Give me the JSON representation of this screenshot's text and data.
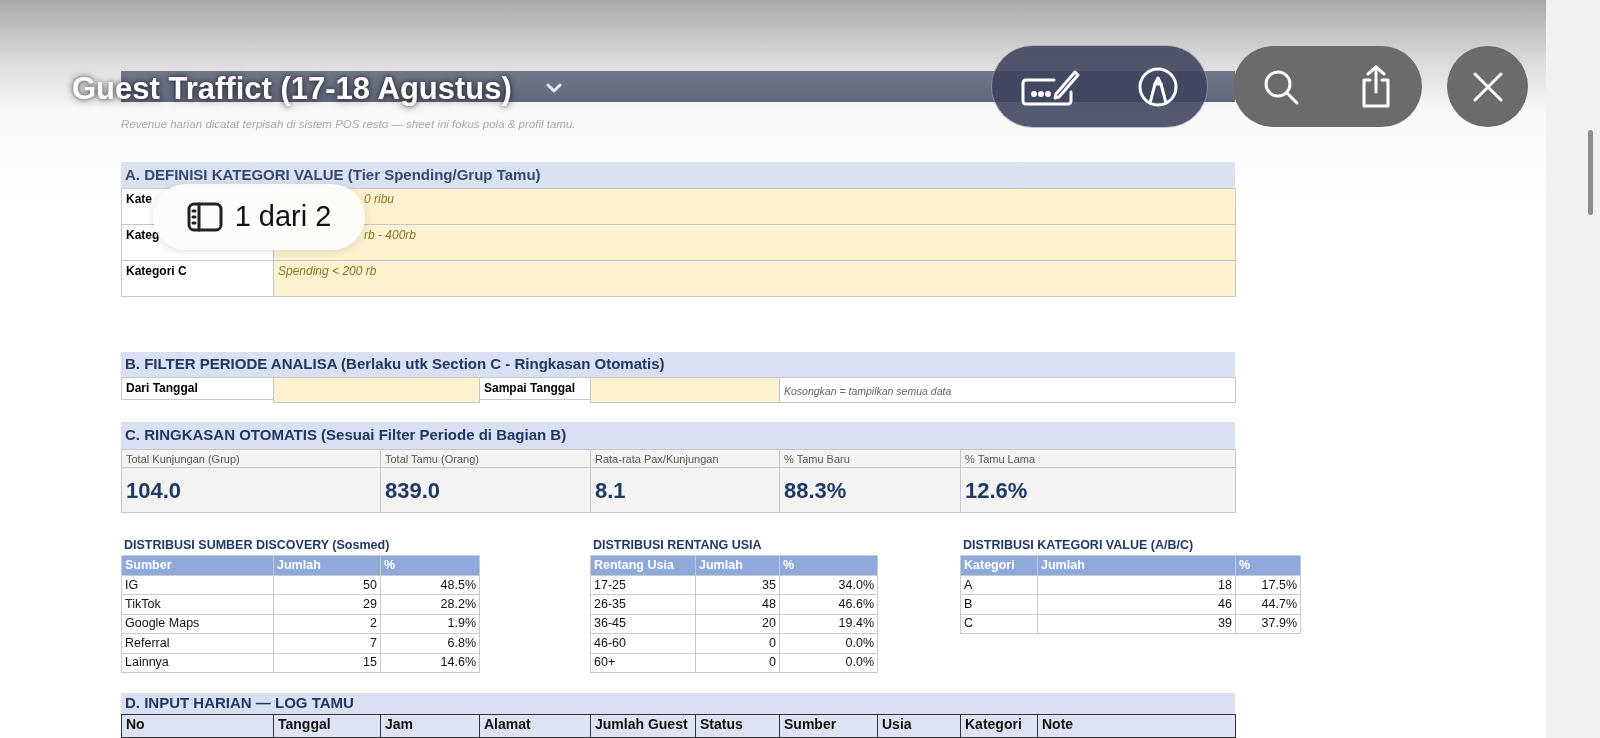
{
  "viewer": {
    "title": "Guest Traffict (17-18 Agustus)",
    "page_indicator": "1 dari 2"
  },
  "sheet": {
    "subtitle": "Revenue harian dicatat terpisah di sistem POS resto — sheet ini fokus pola & profil tamu.",
    "section_a": {
      "title": "A. DEFINISI KATEGORI VALUE (Tier Spending/Grup Tamu)",
      "rows": [
        {
          "label": "Kate",
          "value": "0 ribu"
        },
        {
          "label": "Kateg",
          "value": "rb - 400rb"
        },
        {
          "label": "Kategori C",
          "value": "Spending < 200 rb"
        }
      ]
    },
    "section_b": {
      "title": "B. FILTER PERIODE ANALISA (Berlaku utk Section C - Ringkasan Otomatis)",
      "fields": [
        {
          "label": "Dari Tanggal"
        },
        {
          "label": "Sampai Tanggal"
        }
      ],
      "note": "Kosongkan = tampilkan semua data"
    },
    "section_c": {
      "title": "C. RINGKASAN OTOMATIS (Sesuai Filter Periode di Bagian B)",
      "metrics": [
        {
          "label": "Total Kunjungan (Grup)",
          "value": "104.0"
        },
        {
          "label": "Total Tamu (Orang)",
          "value": "839.0"
        },
        {
          "label": "Rata-rata Pax/Kunjungan",
          "value": "8.1"
        },
        {
          "label": "% Tamu Baru",
          "value": "88.3%"
        },
        {
          "label": "% Tamu Lama",
          "value": "12.6%"
        }
      ]
    },
    "distributions": [
      {
        "title": "DISTRIBUSI SUMBER DISCOVERY (Sosmed)",
        "columns": [
          "Sumber",
          "Jumlah",
          "%"
        ],
        "rows": [
          [
            "IG",
            "50",
            "48.5%"
          ],
          [
            "TikTok",
            "29",
            "28.2%"
          ],
          [
            "Google Maps",
            "2",
            "1.9%"
          ],
          [
            "Referral",
            "7",
            "6.8%"
          ],
          [
            "Lainnya",
            "15",
            "14.6%"
          ]
        ]
      },
      {
        "title": "DISTRIBUSI RENTANG USIA",
        "columns": [
          "Rentang Usia",
          "Jumlah",
          "%"
        ],
        "rows": [
          [
            "17-25",
            "35",
            "34.0%"
          ],
          [
            "26-35",
            "48",
            "46.6%"
          ],
          [
            "36-45",
            "20",
            "19.4%"
          ],
          [
            "46-60",
            "0",
            "0.0%"
          ],
          [
            "60+",
            "0",
            "0.0%"
          ]
        ]
      },
      {
        "title": "DISTRIBUSI KATEGORI VALUE (A/B/C)",
        "columns": [
          "Kategori",
          "Jumlah",
          "%"
        ],
        "rows": [
          [
            "A",
            "18",
            "17.5%"
          ],
          [
            "B",
            "46",
            "44.7%"
          ],
          [
            "C",
            "39",
            "37.9%"
          ]
        ]
      }
    ],
    "section_d": {
      "title": "D. INPUT HARIAN — LOG TAMU",
      "columns": [
        "No",
        "Tanggal",
        "Jam",
        "Alamat",
        "Jumlah Guest",
        "Status",
        "Sumber",
        "Usia",
        "Kategori",
        "Note"
      ]
    }
  }
}
